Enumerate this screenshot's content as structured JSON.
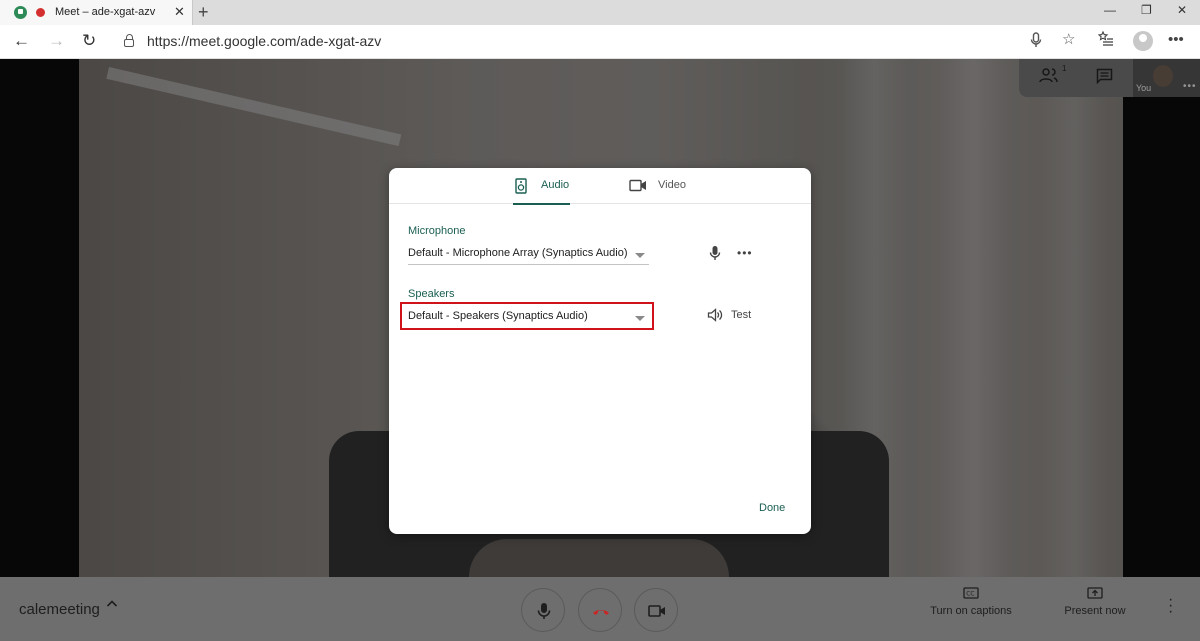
{
  "browser": {
    "tab_title": "Meet – ade-xgat-azv",
    "tab_close": "✕",
    "new_tab": "+",
    "minimize": "—",
    "maximize": "❐",
    "close": "✕",
    "url": "https://meet.google.com/ade-xgat-azv",
    "back": "←",
    "forward": "→",
    "reload": "↻"
  },
  "meet": {
    "participants_count": "1",
    "self_label": "You",
    "self_more": "•••",
    "meeting_name": "calemeeting",
    "captions_label": "Turn on captions",
    "present_label": "Present now"
  },
  "dialog": {
    "tabs": [
      {
        "label": "Audio",
        "icon": "speaker-icon",
        "active": true
      },
      {
        "label": "Video",
        "icon": "camera-icon",
        "active": false
      }
    ],
    "microphone": {
      "label": "Microphone",
      "value": "Default - Microphone Array (Synaptics Audio)"
    },
    "speakers": {
      "label": "Speakers",
      "value": "Default - Speakers (Synaptics Audio)",
      "test_label": "Test"
    },
    "done_label": "Done"
  },
  "colors": {
    "accent": "#1a5e52",
    "highlight": "#d0121b",
    "hangup": "#c62828"
  }
}
